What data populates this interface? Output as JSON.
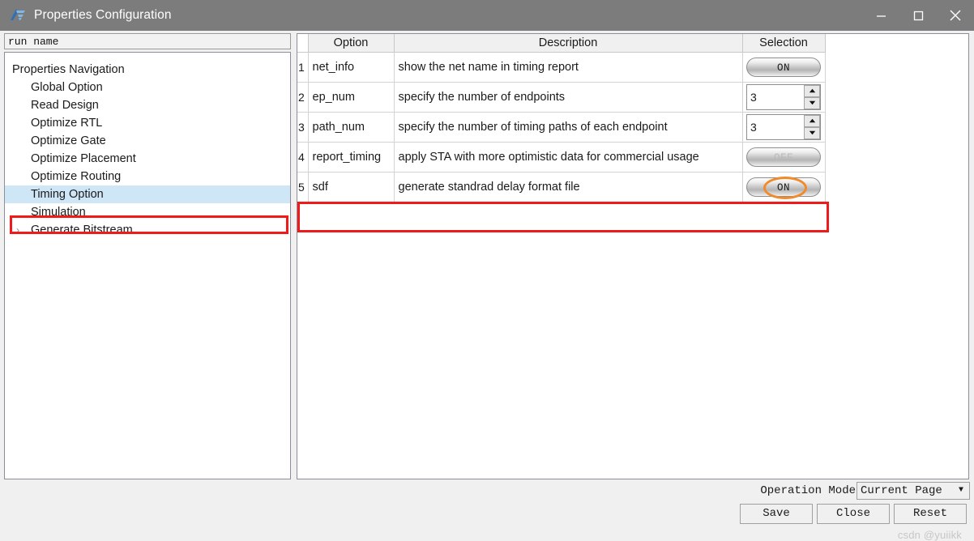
{
  "window": {
    "title": "Properties Configuration",
    "logo_icon": "app-logo-icon",
    "minimize_icon": "minimize-icon",
    "maximize_icon": "maximize-icon",
    "close_icon": "close-icon",
    "titlebar_color": "#7c7c7c"
  },
  "left_panel": {
    "run_name_value": "run name",
    "tree": [
      {
        "label": "Properties Navigation",
        "level": 0,
        "arrow": "",
        "selected": false
      },
      {
        "label": "Global Option",
        "level": 1,
        "arrow": "",
        "selected": false
      },
      {
        "label": "Read Design",
        "level": 1,
        "arrow": "",
        "selected": false
      },
      {
        "label": "Optimize RTL",
        "level": 1,
        "arrow": "",
        "selected": false
      },
      {
        "label": "Optimize Gate",
        "level": 1,
        "arrow": "",
        "selected": false
      },
      {
        "label": "Optimize Placement",
        "level": 1,
        "arrow": "",
        "selected": false
      },
      {
        "label": "Optimize Routing",
        "level": 1,
        "arrow": "",
        "selected": false
      },
      {
        "label": "Timing Option",
        "level": 1,
        "arrow": "",
        "selected": true
      },
      {
        "label": "Simulation",
        "level": 1,
        "arrow": "",
        "selected": false
      },
      {
        "label": "Generate Bitstream",
        "level": 1,
        "arrow": "›",
        "selected": false
      }
    ]
  },
  "table": {
    "headers": {
      "num": "",
      "option": "Option",
      "description": "Description",
      "selection": "Selection"
    },
    "rows": [
      {
        "num": "1",
        "option": "net_info",
        "description": "show the net name in timing report",
        "control": "toggle",
        "value": "ON",
        "state": "on",
        "annotated": false
      },
      {
        "num": "2",
        "option": "ep_num",
        "description": "specify the number of endpoints",
        "control": "spinner",
        "value": "3",
        "state": "",
        "annotated": false
      },
      {
        "num": "3",
        "option": "path_num",
        "description": "specify the number of timing paths of each endpoint",
        "control": "spinner",
        "value": "3",
        "state": "",
        "annotated": false
      },
      {
        "num": "4",
        "option": "report_timing",
        "description": "apply STA with more optimistic data for commercial usage",
        "control": "toggle",
        "value": "OFF",
        "state": "off",
        "annotated": false
      },
      {
        "num": "5",
        "option": "sdf",
        "description": "generate standrad delay format file",
        "control": "toggle",
        "value": "ON",
        "state": "on",
        "annotated": true
      }
    ]
  },
  "annotations": {
    "tree_highlight_color": "#f01a1a",
    "row_highlight_color": "#f01a1a",
    "ellipse_color": "#f08a2a"
  },
  "bottom": {
    "operation_mode_label": "Operation Mode",
    "operation_mode_value": "Current Page",
    "dropdown_arrow_icon": "chevron-down-icon",
    "save_label": "Save",
    "close_label": "Close",
    "reset_label": "Reset"
  },
  "watermark": {
    "text": "csdn @yuiikk"
  }
}
